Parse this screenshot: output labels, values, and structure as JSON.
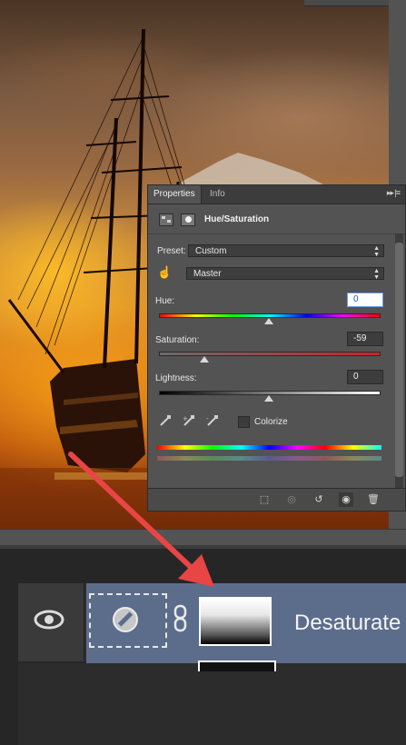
{
  "properties_panel": {
    "tabs": [
      {
        "label": "Properties",
        "active": true
      },
      {
        "label": "Info",
        "active": false
      }
    ],
    "adjustment_title": "Hue/Saturation",
    "preset": {
      "label": "Preset:",
      "value": "Custom"
    },
    "channel": {
      "value": "Master"
    },
    "hue": {
      "label": "Hue:",
      "value": "0",
      "slider_fraction": 0.5
    },
    "saturation": {
      "label": "Saturation:",
      "value": "-59",
      "slider_fraction": 0.205
    },
    "lightness": {
      "label": "Lightness:",
      "value": "0",
      "slider_fraction": 0.5
    },
    "colorize": {
      "label": "Colorize",
      "checked": false
    }
  },
  "layers_panel": {
    "selected_layer": {
      "name": "Desaturate",
      "visible": true,
      "highlight_color": "#5c6d8c"
    }
  },
  "annotation": {
    "arrow_color": "#e84545"
  },
  "colors": {
    "panel_bg": "#535353",
    "panel_dark": "#3c3c3c",
    "app_bg": "#262626"
  }
}
